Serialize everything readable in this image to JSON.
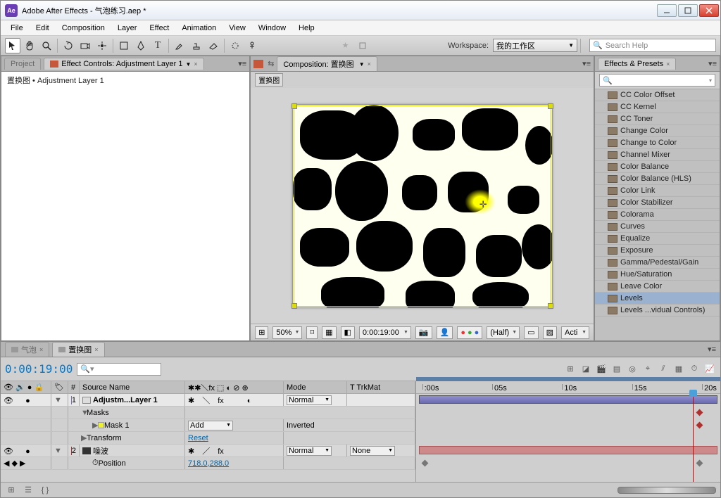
{
  "titlebar": {
    "app": "Adobe After Effects",
    "sep": " - ",
    "file": "气泡练习.aep *"
  },
  "menu": [
    "File",
    "Edit",
    "Composition",
    "Layer",
    "Effect",
    "Animation",
    "View",
    "Window",
    "Help"
  ],
  "toolbar": {
    "workspace_label": "Workspace:",
    "workspace_value": "我的工作区",
    "search_placeholder": "Search Help"
  },
  "left": {
    "tab_project": "Project",
    "tab_effect_controls": "Effect Controls: Adjustment Layer 1",
    "breadcrumb_comp": "置换图",
    "breadcrumb_sep": " • ",
    "breadcrumb_layer": "Adjustment Layer 1"
  },
  "comp": {
    "tab_label": "Composition: 置换图",
    "dropdown": "置换图",
    "footer": {
      "zoom": "50%",
      "time": "0:00:19:00",
      "res": "(Half)",
      "view": "Acti"
    }
  },
  "effects_panel": {
    "title": "Effects & Presets",
    "search_icon": "🔍",
    "items": [
      "CC Color Offset",
      "CC Kernel",
      "CC Toner",
      "Change Color",
      "Change to Color",
      "Channel Mixer",
      "Color Balance",
      "Color Balance (HLS)",
      "Color Link",
      "Color Stabilizer",
      "Colorama",
      "Curves",
      "Equalize",
      "Exposure",
      "Gamma/Pedestal/Gain",
      "Hue/Saturation",
      "Leave Color",
      "Levels",
      "Levels ...vidual Controls)"
    ],
    "selected_index": 17
  },
  "timeline": {
    "tab1": "气泡",
    "tab2": "置换图",
    "timecode": "0:00:19:00",
    "ruler": [
      ":00s",
      "05s",
      "10s",
      "15s",
      "20s"
    ],
    "cols": {
      "num": "#",
      "source": "Source Name",
      "mode": "Mode",
      "trk": "T   TrkMat"
    },
    "layers": [
      {
        "num": "1",
        "name": "Adjustm...Layer 1",
        "mode": "Normal",
        "color": "#7a6da8"
      },
      {
        "num": "2",
        "name": "噪波",
        "mode": "Normal",
        "trk": "None",
        "color": "#a03030"
      }
    ],
    "masks_label": "Masks",
    "mask1_label": "Mask 1",
    "mask1_mode": "Add",
    "mask1_inverted": "Inverted",
    "transform_label": "Transform",
    "transform_reset": "Reset",
    "position_label": "Position",
    "position_value": "718.0,288.0"
  }
}
